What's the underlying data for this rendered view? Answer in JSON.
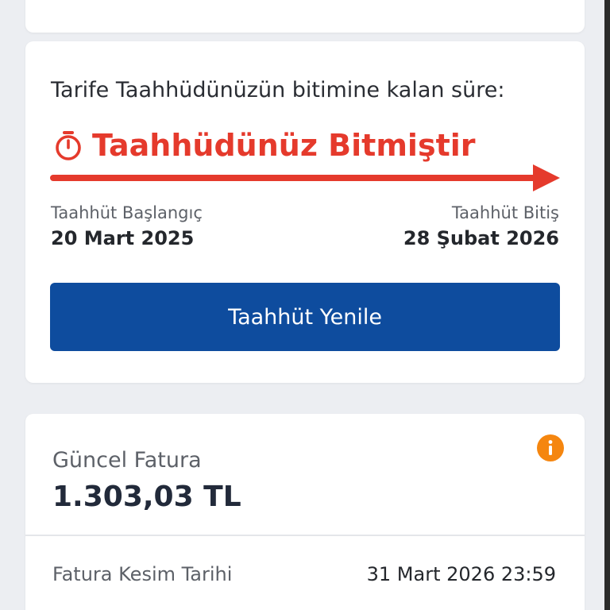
{
  "commitment": {
    "heading": "Tarife Taahhüdünüzün bitimine kalan süre:",
    "status_text": "Taahhüdünüz Bitmiştir",
    "status_icon": "stopwatch-icon",
    "start_label": "Taahhüt Başlangıç",
    "start_date": "20 Mart 2025",
    "end_label": "Taahhüt Bitiş",
    "end_date": "28 Şubat 2026",
    "renew_button_label": "Taahhüt Yenile"
  },
  "bill": {
    "label": "Güncel Fatura",
    "amount": "1.303,03 TL",
    "info_icon": "info-icon",
    "cut_date_label": "Fatura Kesim Tarihi",
    "cut_date_value": "31 Mart 2026 23:59"
  },
  "colors": {
    "alert_red": "#e53a2c",
    "primary_blue": "#0e4c9e",
    "info_orange": "#f5860f",
    "background": "#eceef2"
  }
}
